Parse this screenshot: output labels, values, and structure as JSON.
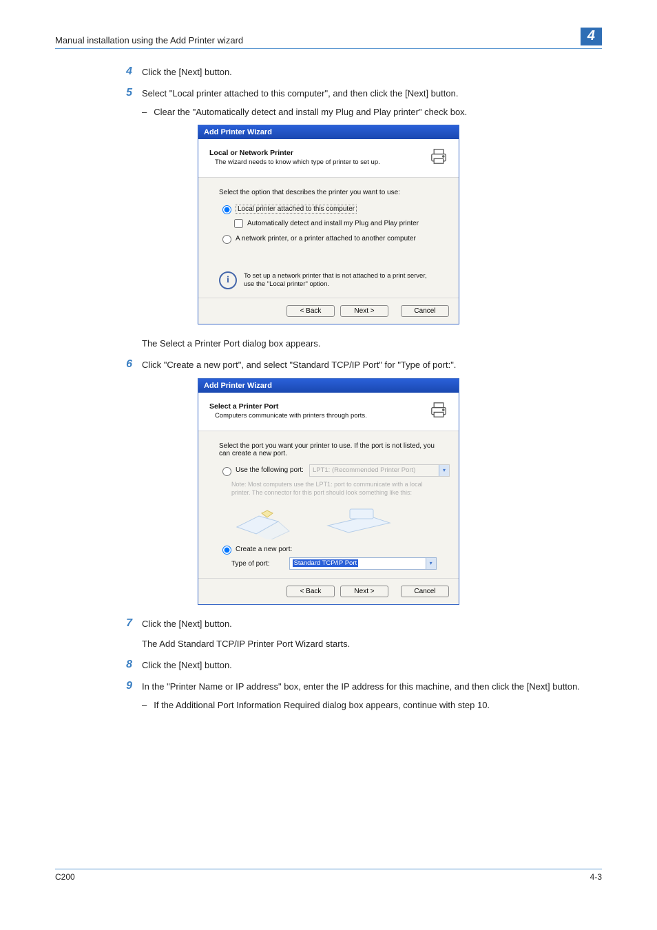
{
  "header": {
    "title": "Manual installation using the Add Printer wizard",
    "chapter": "4"
  },
  "steps": [
    {
      "n": "4",
      "text": "Click the [Next] button."
    },
    {
      "n": "5",
      "text": "Select \"Local printer attached to this computer\", and then click the [Next] button.",
      "sub": [
        "Clear the \"Automatically detect and install my Plug and Play printer\" check box."
      ]
    },
    {
      "after_img_text": "The Select a Printer Port dialog box appears."
    },
    {
      "n": "6",
      "text": "Click \"Create a new port\", and select \"Standard TCP/IP Port\" for \"Type of port:\"."
    },
    {
      "n": "7",
      "text": "Click the [Next] button.",
      "after_text": "The Add Standard TCP/IP Printer Port Wizard starts."
    },
    {
      "n": "8",
      "text": "Click the [Next] button."
    },
    {
      "n": "9",
      "text": "In the \"Printer Name or IP address\" box, enter the IP address for this machine, and then click the [Next] button.",
      "sub": [
        "If the Additional Port Information Required dialog box appears, continue with step 10."
      ]
    }
  ],
  "wizard1": {
    "title": "Add Printer Wizard",
    "head_h1": "Local or Network Printer",
    "head_h2": "The wizard needs to know which type of printer to set up.",
    "prompt": "Select the option that describes the printer you want to use:",
    "opt1": "Local printer attached to this computer",
    "opt1_sub": "Automatically detect and install my Plug and Play printer",
    "opt2": "A network printer, or a printer attached to another computer",
    "info": "To set up a network printer that is not attached to a print server, use the \"Local printer\" option.",
    "back": "< Back",
    "next": "Next >",
    "cancel": "Cancel"
  },
  "wizard2": {
    "title": "Add Printer Wizard",
    "head_h1": "Select a Printer Port",
    "head_h2": "Computers communicate with printers through ports.",
    "prompt": "Select the port you want your printer to use. If the port is not listed, you can create a new port.",
    "opt_use": "Use the following port:",
    "use_val": "LPT1: (Recommended Printer Port)",
    "note": "Note: Most computers use the LPT1: port to communicate with a local printer. The connector for this port should look something like this:",
    "opt_create": "Create a new port:",
    "type_label": "Type of port:",
    "type_val": "Standard TCP/IP Port",
    "back": "< Back",
    "next": "Next >",
    "cancel": "Cancel"
  },
  "footer": {
    "left": "C200",
    "right": "4-3"
  }
}
